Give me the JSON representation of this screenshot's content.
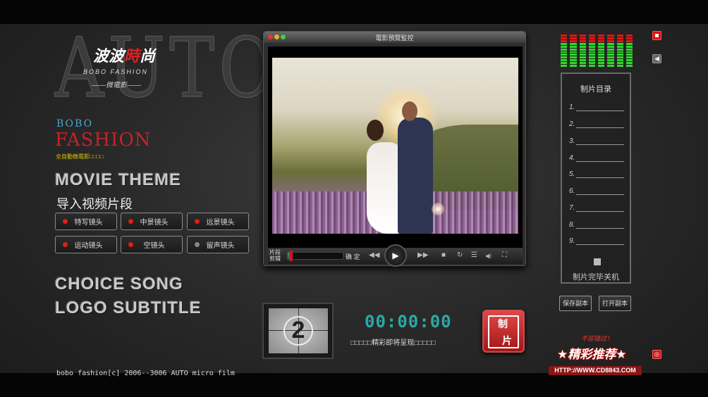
{
  "logo": {
    "auto": "AUTO",
    "brand_cn": "波波",
    "brand_cn_red": "時",
    "brand_cn_tail": "尚",
    "brand_en": "BOBO FASHION",
    "brand_sub": "——微電影——",
    "bobo": "BOBO",
    "fashion": "FASHION",
    "fashion_sub": "全自動微電影□□□□"
  },
  "left_panel": {
    "movie_theme": "MOVIE THEME",
    "import_label": "导入视频片段",
    "shot_buttons": [
      "特写镜头",
      "中景镜头",
      "远景镜头",
      "运动镜头",
      "空镜头",
      "留声镜头"
    ],
    "choice_song": "CHOICE SONG",
    "logo_subtitle": "LOGO SUBTITLE"
  },
  "footer": {
    "text": "bobo fashion[c] 2006--3006 AUTO micro film"
  },
  "player": {
    "title": "電影預覽監控",
    "clip_label": "片段剪辑",
    "confirm": "确 定",
    "progress": 0.05,
    "buttons": {
      "rewind": "◀◀",
      "play": "▶",
      "forward": "▶▶",
      "stop": "■",
      "refresh": "↻",
      "list": "☰",
      "volume": "◀)",
      "fullscreen": "⛶"
    }
  },
  "countdown": {
    "number": "2"
  },
  "timer": {
    "time": "00:00:00",
    "subtitle": "□□□□□精彩即将呈现□□□□□"
  },
  "make_button": {
    "line1": "制",
    "line2": "片"
  },
  "catalog": {
    "title": "制片目录",
    "items": [
      "1.",
      "2.",
      "3.",
      "4.",
      "5.",
      "6.",
      "7.",
      "8.",
      "9."
    ],
    "shutdown": "制片完毕关机"
  },
  "side_buttons": {
    "save": "保存副本",
    "open": "打开副本"
  },
  "promo": {
    "small": "不容错过！",
    "big": "★精彩推荐★",
    "url": "HTTP://WWW.CD8843.COM"
  },
  "colors": {
    "accent_red": "#e41b1b",
    "timer_teal": "#2aa9a6",
    "vu_green": "#2fd62f",
    "vu_red": "#e01515"
  }
}
